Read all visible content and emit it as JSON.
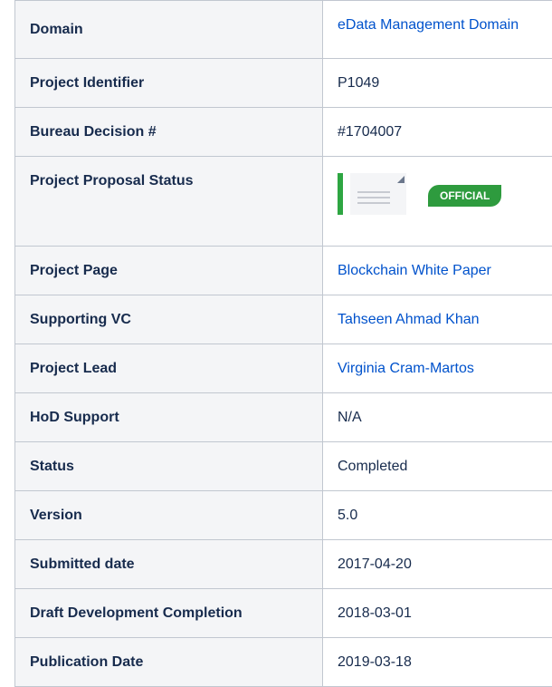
{
  "rows": [
    {
      "label": "Domain",
      "value": "eData Management Domain",
      "link": true
    },
    {
      "label": "Project Identifier",
      "value": "P1049"
    },
    {
      "label": "Bureau Decision #",
      "value": "#1704007"
    },
    {
      "label": "Project Proposal Status",
      "badge": "OFFICIAL",
      "icon": "document-thumbnail-icon"
    },
    {
      "label": "Project Page",
      "value": "Blockchain White Paper",
      "link": true
    },
    {
      "label": "Supporting VC",
      "value": "Tahseen Ahmad Khan",
      "link": true
    },
    {
      "label": "Project Lead",
      "value": "Virginia Cram-Martos",
      "link": true
    },
    {
      "label": "HoD Support",
      "value": "N/A"
    },
    {
      "label": "Status",
      "value": "Completed"
    },
    {
      "label": "Version",
      "value": "5.0"
    },
    {
      "label": "Submitted date",
      "value": "2017-04-20"
    },
    {
      "label": "Draft Development Completion",
      "value": "2018-03-01"
    },
    {
      "label": "Publication Date",
      "value": "2019-03-18"
    }
  ],
  "colors": {
    "link": "#0052cc",
    "badge": "#2e9b3e",
    "header_bg": "#f4f5f7"
  }
}
